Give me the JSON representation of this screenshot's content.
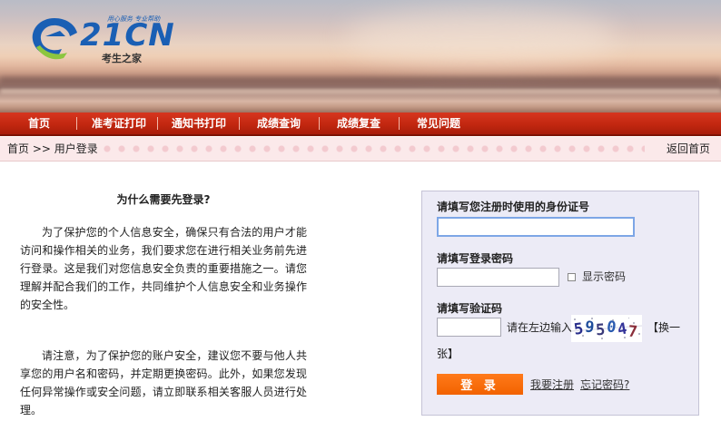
{
  "header": {
    "brand": "21CN",
    "slogan": "用心服务 专业帮助",
    "subtitle": "考生之家"
  },
  "nav": [
    {
      "label": "首页"
    },
    {
      "label": "准考证打印"
    },
    {
      "label": "通知书打印"
    },
    {
      "label": "成绩查询"
    },
    {
      "label": "成绩复查"
    },
    {
      "label": "常见问题"
    }
  ],
  "breadcrumb": {
    "home": "首页",
    "separator": ">>",
    "current": "用户登录",
    "back": "返回首页"
  },
  "info": {
    "title": "为什么需要先登录?",
    "paragraph1": "为了保护您的个人信息安全，确保只有合法的用户才能访问和操作相关的业务，我们要求您在进行相关业务前先进行登录。这是我们对您信息安全负责的重要措施之一。请您理解并配合我们的工作，共同维护个人信息安全和业务操作的安全性。",
    "paragraph2": "请注意，为了保护您的账户安全，建议您不要与他人共享您的用户名和密码，并定期更换密码。此外，如果您发现任何异常操作或安全问题，请立即联系相关客服人员进行处理。"
  },
  "login": {
    "id_label": "请填写您注册时使用的身份证号",
    "id_value": "",
    "password_label": "请填写登录密码",
    "password_value": "",
    "show_password": "显示密码",
    "captcha_label": "请填写验证码",
    "captcha_value": "",
    "captcha_hint": "请在左边输入",
    "captcha_code": "595047",
    "refresh_part1": "【换一",
    "refresh_part2": "张】",
    "submit": "登 录",
    "register": "我要注册",
    "forgot": "忘记密码?"
  },
  "colors": {
    "nav_red": "#c22710",
    "button_orange": "#f26200",
    "login_bg": "#ecebf6",
    "brand_blue": "#1a5fb4"
  }
}
